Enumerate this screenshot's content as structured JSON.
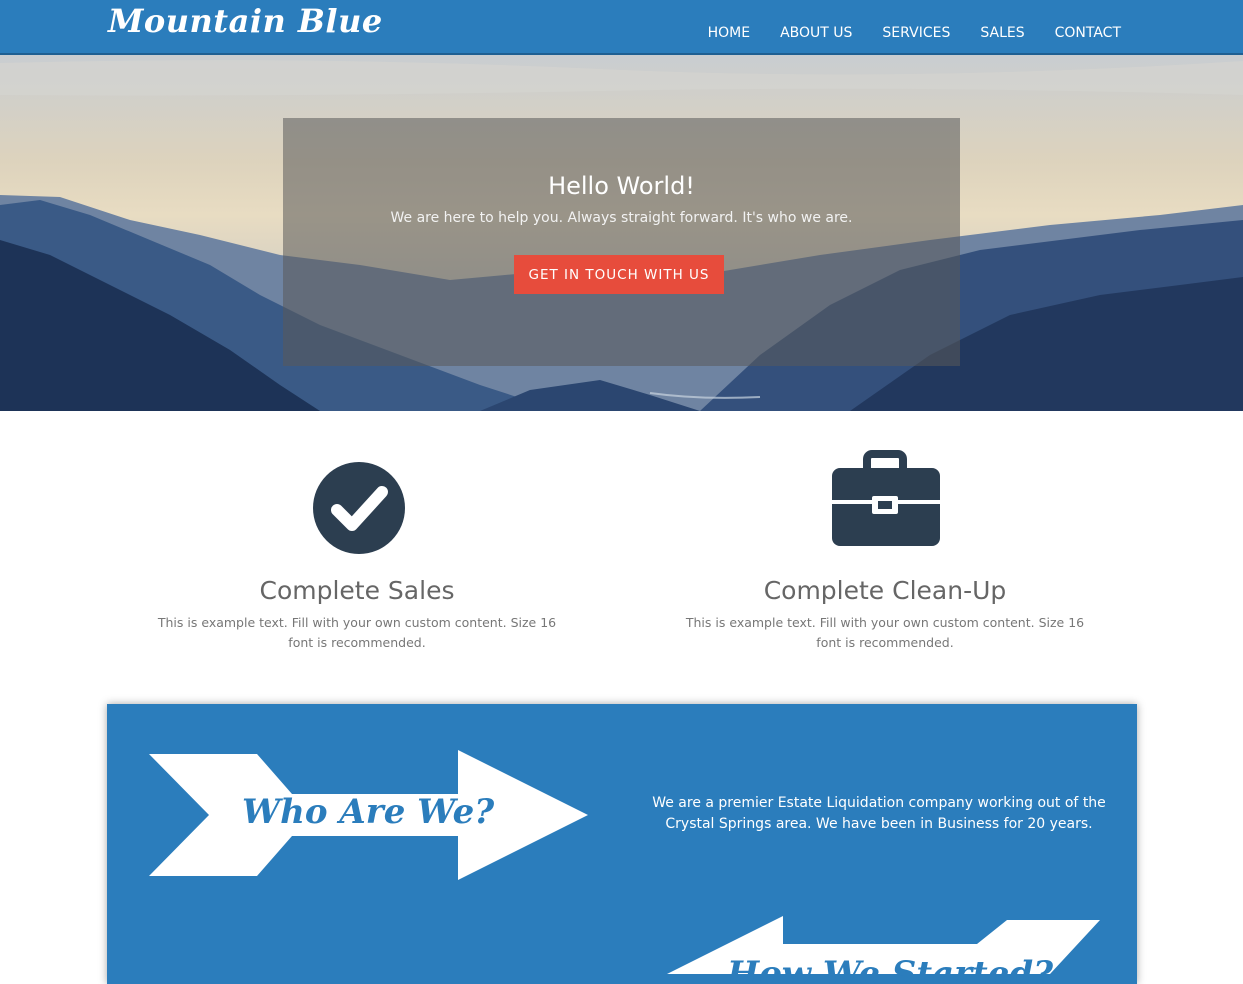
{
  "brand": {
    "logo": "Mountain Blue"
  },
  "nav": {
    "items": [
      "HOME",
      "ABOUT US",
      "SERVICES",
      "SALES",
      "CONTACT"
    ]
  },
  "hero": {
    "title": "Hello World!",
    "subtitle": "We are here to help you. Always straight forward. It's who we are.",
    "cta_label": "GET IN TOUCH WITH US"
  },
  "features": [
    {
      "icon": "check-circle-icon",
      "title": "Complete Sales",
      "text": "This is example text. Fill with your own custom content. Size 16 font is recommended."
    },
    {
      "icon": "briefcase-icon",
      "title": "Complete Clean-Up",
      "text": "This is example text. Fill with your own custom content. Size 16 font is recommended."
    }
  ],
  "about": {
    "arrow_label": "Who Are We?",
    "text": "We are a premier Estate Liquidation company working out of the Crystal Springs area. We have been in Business for 20 years.",
    "second_arrow_label": "How We Started?"
  },
  "colors": {
    "brand_blue": "#2b7dbc",
    "cta_red": "#e74c3c",
    "icon_navy": "#2c3e50"
  }
}
